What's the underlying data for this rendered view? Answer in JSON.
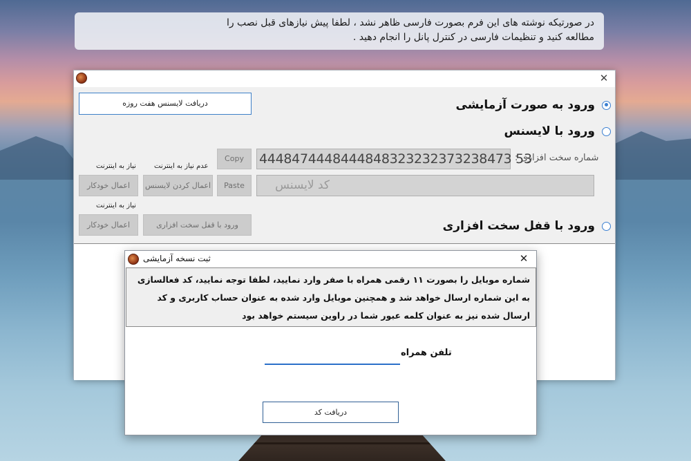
{
  "banner": {
    "line1": "در صورتیکه نوشته های این فرم بصورت فارسی ظاهر نشد ، لطفا پیش نیازهای قبل نصب را",
    "line2": "مطالعه کنید و تنظیمات فارسی در کنترل پانل را انجام دهید ."
  },
  "main_window": {
    "close_glyph": "✕",
    "trial_license_button": "دریافت لایسنس هفت روزه",
    "options": {
      "trial": "ورود به صورت آزمایشی",
      "license": "ورود با لایسنس",
      "hardware_lock": "ورود با قفل سخت افزاری"
    },
    "selected_option": "trial",
    "serial_label": "شماره سخت افزاری :",
    "serial_value": "4448474448444848323232373238473 53",
    "license_placeholder": "کد لایسنس",
    "copy_button": "Copy",
    "paste_button": "Paste",
    "note_no_internet_needed": "عدم نیاز به اینترنت",
    "note_internet_needed_1": "نیاز به اینترنت",
    "note_internet_needed_2": "نیاز به اینترنت",
    "apply_license_button": "اعمال کردن لایسنس",
    "auto_apply_button_1": "اعمال خودکار",
    "auto_apply_button_2": "اعمال خودکار",
    "hardware_lock_button": "ورود با قفل سخت افزاری"
  },
  "dialog": {
    "title": "ثبت نسخه آزمایشی",
    "close_glyph": "✕",
    "message": "شماره موبایل را بصورت ۱۱ رقمی همراه با صفر وارد نمایید، لطفا توجه نمایید، کد فعالسازی به این شماره ارسال خواهد شد و همچنین موبایل وارد شده به عنوان حساب کاربری و کد ارسال شده نیز به عنوان کلمه عبور شما در راوین سیستم خواهد بود",
    "phone_label": "تلفن همراه",
    "phone_value": "",
    "get_code_button": "دریافت کد"
  }
}
